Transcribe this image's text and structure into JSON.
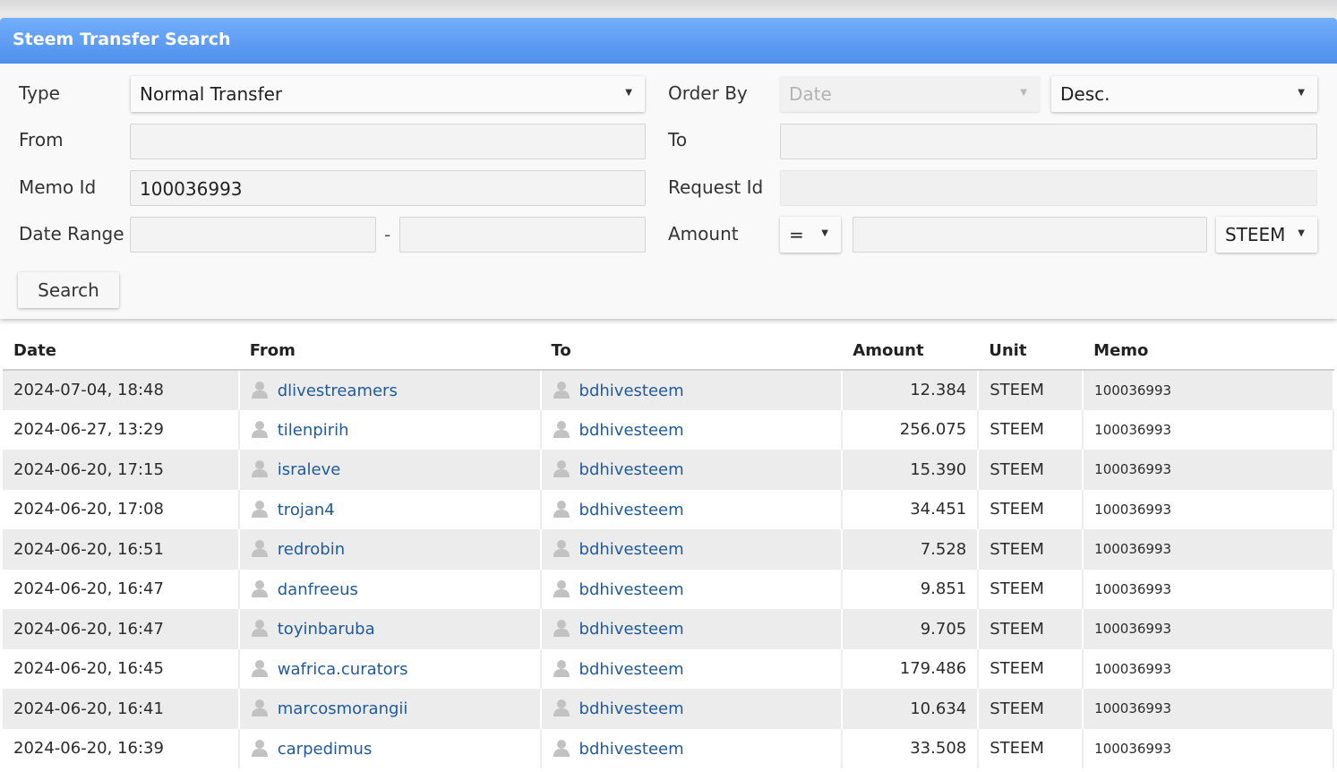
{
  "header": {
    "title": "Steem Transfer Search"
  },
  "form": {
    "type_label": "Type",
    "type_value": "Normal Transfer",
    "order_by_label": "Order By",
    "order_by_value": "Date",
    "order_dir_value": "Desc.",
    "from_label": "From",
    "from_value": "",
    "to_label": "To",
    "to_value": "",
    "memo_id_label": "Memo Id",
    "memo_id_value": "100036993",
    "request_id_label": "Request Id",
    "request_id_value": "",
    "date_range_label": "Date Range",
    "date_range_sep": "-",
    "date_start": "",
    "date_end": "",
    "amount_label": "Amount",
    "amount_op": "=",
    "amount_value": "",
    "amount_unit": "STEEM",
    "search_label": "Search"
  },
  "table": {
    "columns": [
      "Date",
      "From",
      "To",
      "Amount",
      "Unit",
      "Memo"
    ],
    "rows": [
      {
        "date": "2024-07-04, 18:48",
        "from": "dlivestreamers",
        "to": "bdhivesteem",
        "amount": "12.384",
        "unit": "STEEM",
        "memo": "100036993"
      },
      {
        "date": "2024-06-27, 13:29",
        "from": "tilenpirih",
        "to": "bdhivesteem",
        "amount": "256.075",
        "unit": "STEEM",
        "memo": "100036993"
      },
      {
        "date": "2024-06-20, 17:15",
        "from": "israleve",
        "to": "bdhivesteem",
        "amount": "15.390",
        "unit": "STEEM",
        "memo": "100036993"
      },
      {
        "date": "2024-06-20, 17:08",
        "from": "trojan4",
        "to": "bdhivesteem",
        "amount": "34.451",
        "unit": "STEEM",
        "memo": "100036993"
      },
      {
        "date": "2024-06-20, 16:51",
        "from": "redrobin",
        "to": "bdhivesteem",
        "amount": "7.528",
        "unit": "STEEM",
        "memo": "100036993"
      },
      {
        "date": "2024-06-20, 16:47",
        "from": "danfreeus",
        "to": "bdhivesteem",
        "amount": "9.851",
        "unit": "STEEM",
        "memo": "100036993"
      },
      {
        "date": "2024-06-20, 16:47",
        "from": "toyinbaruba",
        "to": "bdhivesteem",
        "amount": "9.705",
        "unit": "STEEM",
        "memo": "100036993"
      },
      {
        "date": "2024-06-20, 16:45",
        "from": "wafrica.curators",
        "to": "bdhivesteem",
        "amount": "179.486",
        "unit": "STEEM",
        "memo": "100036993"
      },
      {
        "date": "2024-06-20, 16:41",
        "from": "marcosmorangii",
        "to": "bdhivesteem",
        "amount": "10.634",
        "unit": "STEEM",
        "memo": "100036993"
      },
      {
        "date": "2024-06-20, 16:39",
        "from": "carpedimus",
        "to": "bdhivesteem",
        "amount": "33.508",
        "unit": "STEEM",
        "memo": "100036993"
      }
    ]
  }
}
